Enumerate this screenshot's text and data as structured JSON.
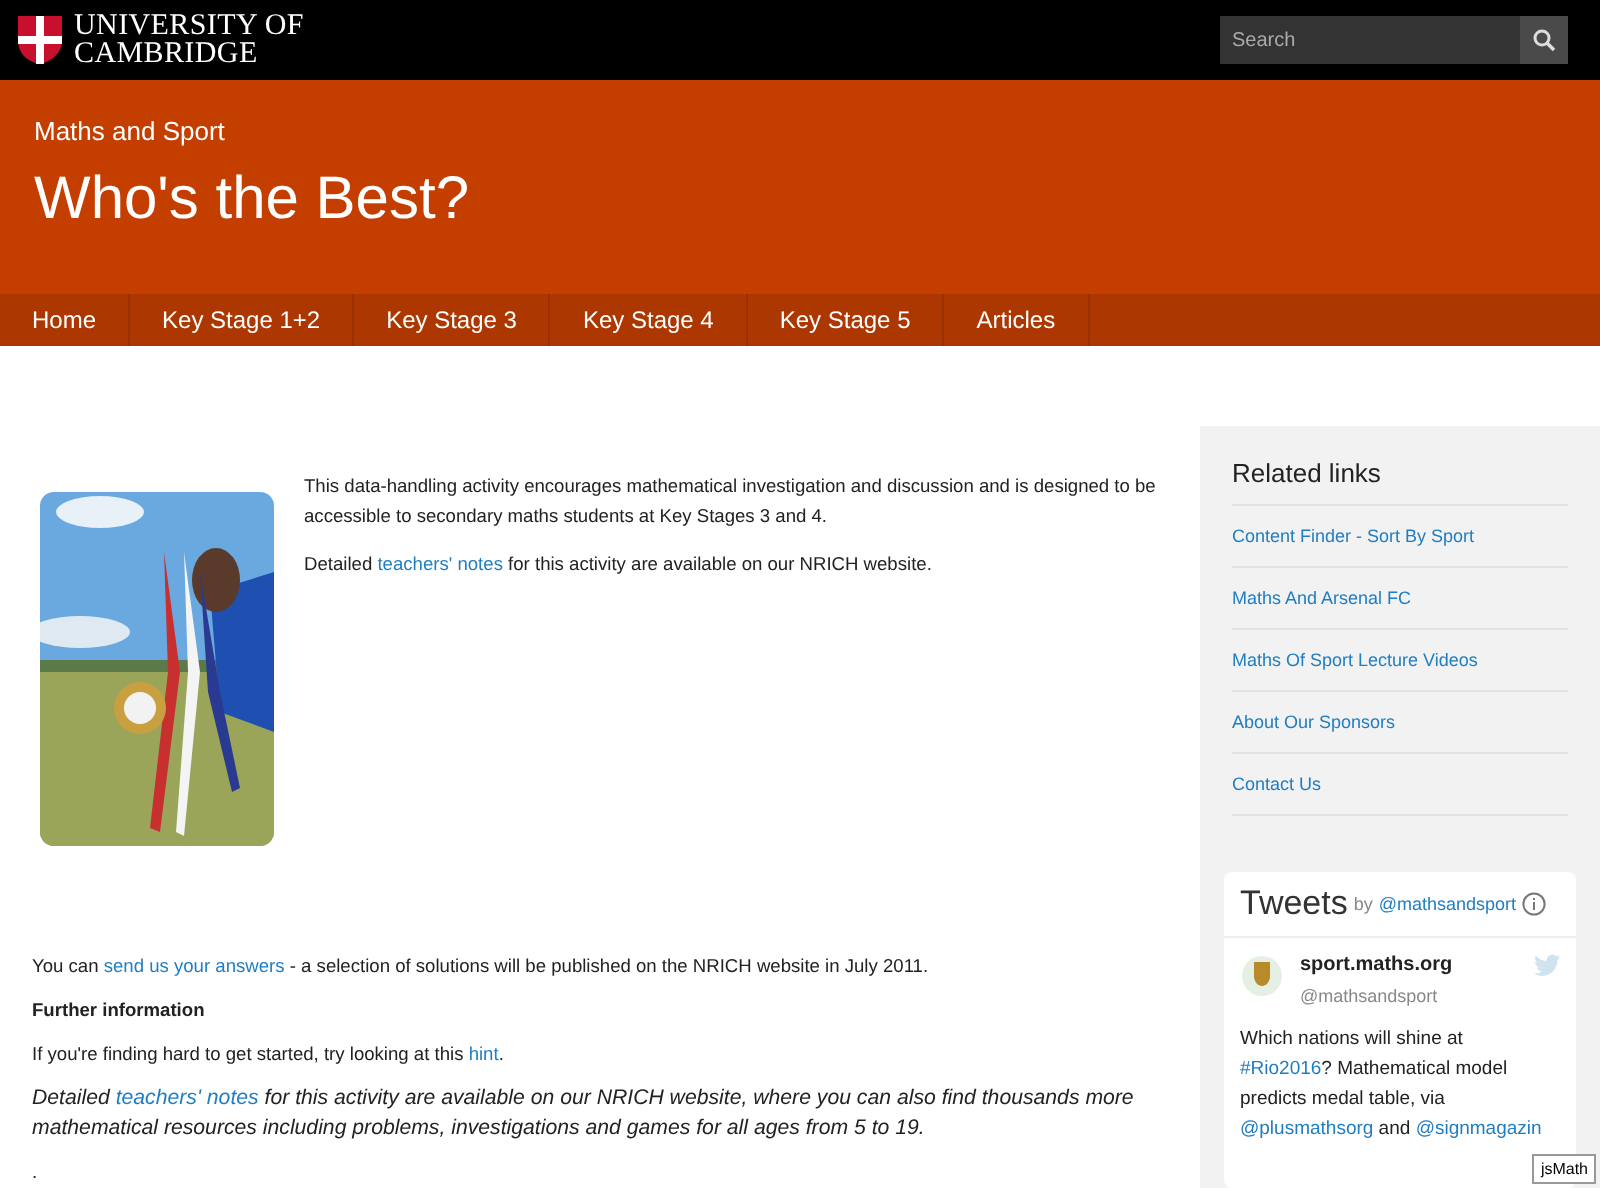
{
  "header": {
    "logo_text": [
      "UNIVERSITY OF",
      "CAMBRIDGE"
    ],
    "search": {
      "placeholder": "Search"
    }
  },
  "banner": {
    "section": "Maths and Sport",
    "title": "Who's the Best?"
  },
  "nav": [
    {
      "label": "Home"
    },
    {
      "label": "Key Stage 1+2"
    },
    {
      "label": "Key Stage 3"
    },
    {
      "label": "Key Stage 4"
    },
    {
      "label": "Key Stage 5"
    },
    {
      "label": "Articles"
    }
  ],
  "intro": {
    "image": {
      "kind": "picture"
    },
    "paragraphs": [
      [
        {
          "kind": "text",
          "text": "This data-handling activity encourages mathematical investigation and discussion and is designed to be accessible to secondary maths students at Key Stages 3 and 4."
        }
      ],
      [
        {
          "kind": "text",
          "text": "Detailed "
        },
        {
          "kind": "link",
          "text": "teachers' notes"
        },
        {
          "kind": "text",
          "text": " for this activity are available on our NRICH website."
        }
      ]
    ]
  },
  "body": [
    {
      "kind": "normal",
      "parts": [
        {
          "kind": "text",
          "text": "You can "
        },
        {
          "kind": "link",
          "text": "send us your answers"
        },
        {
          "kind": "text",
          "text": " - a selection of solutions will be published on the NRICH website in July 2011."
        }
      ]
    },
    {
      "kind": "heading",
      "parts": [
        {
          "kind": "text",
          "text": "Further information"
        }
      ]
    },
    {
      "kind": "normal",
      "parts": [
        {
          "kind": "text",
          "text": "If you're finding hard to get started, try looking at this "
        },
        {
          "kind": "link",
          "text": "hint"
        },
        {
          "kind": "text",
          "text": "."
        }
      ]
    },
    {
      "kind": "italic",
      "parts": [
        {
          "kind": "text",
          "text": "Detailed "
        },
        {
          "kind": "link",
          "text": "teachers' notes"
        },
        {
          "kind": "text",
          "text": " for this activity are available on our NRICH website, where you can also find thousands more mathematical resources including problems, investigations and games for all ages from 5 to 19."
        }
      ]
    },
    {
      "kind": "normal",
      "parts": [
        {
          "kind": "text",
          "text": "."
        }
      ]
    }
  ],
  "related_links": {
    "title": "Related links",
    "items": [
      "Content Finder - Sort By Sport",
      "Maths And Arsenal FC",
      "Maths Of Sport Lecture Videos",
      "About Our Sponsors",
      "Contact Us"
    ]
  },
  "tweets": {
    "title": "Tweets",
    "by": "by",
    "handle": "@mathsandsport",
    "tweet": {
      "name": "sport.maths.org",
      "handle": "@mathsandsport",
      "parts": [
        {
          "kind": "text",
          "text": "Which nations will shine at "
        },
        {
          "kind": "link",
          "text": "#Rio2016"
        },
        {
          "kind": "text",
          "text": "? Mathematical model predicts medal table, via "
        },
        {
          "kind": "link",
          "text": "@plusmathsorg"
        },
        {
          "kind": "text",
          "text": " and "
        },
        {
          "kind": "link",
          "text": "@signmagazin"
        }
      ]
    }
  },
  "badge": "jsMath"
}
